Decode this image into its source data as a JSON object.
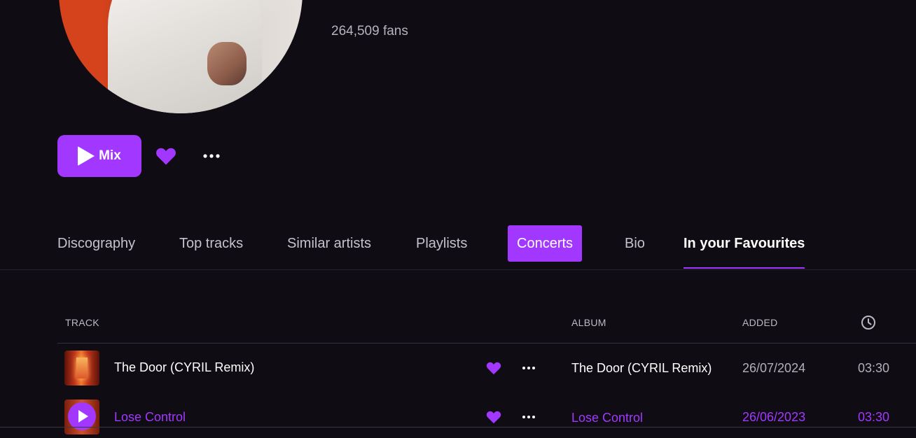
{
  "artist": {
    "fans_text": "264,509 fans"
  },
  "actions": {
    "mix_label": "Mix",
    "favourite_icon": "heart-icon",
    "more_icon": "more-dots-icon"
  },
  "tabs": [
    {
      "label": "Discography"
    },
    {
      "label": "Top tracks"
    },
    {
      "label": "Similar artists"
    },
    {
      "label": "Playlists"
    },
    {
      "label": "Concerts"
    },
    {
      "label": "Bio"
    },
    {
      "label": "In your Favourites"
    }
  ],
  "table": {
    "headers": {
      "track": "TRACK",
      "album": "ALBUM",
      "added": "ADDED",
      "duration_icon": "clock-icon"
    },
    "rows": [
      {
        "title": "The Door (CYRIL Remix)",
        "album": "The Door (CYRIL Remix)",
        "added": "26/07/2024",
        "duration": "03:30",
        "playing": false
      },
      {
        "title": "Lose Control",
        "album": "Lose Control",
        "added": "26/06/2023",
        "duration": "03:30",
        "playing": true
      }
    ]
  },
  "colors": {
    "accent": "#a238ff",
    "background": "#0f0d13",
    "text_dim": "#b3afb9"
  }
}
